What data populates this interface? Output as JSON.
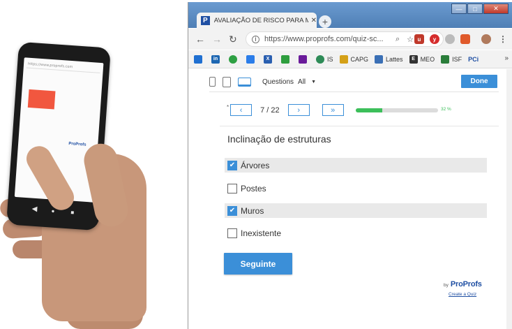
{
  "photo": {
    "phone_url": "https://www.proprofs.com",
    "phone_logo": "ProProfs",
    "phone_nav": [
      "◀",
      "●",
      "■"
    ]
  },
  "browser": {
    "tab_title": "AVALIAÇÃO DE RISCO PARA MO",
    "tab_favicon": "P",
    "url": "https://www.proprofs.com/quiz-sc...",
    "window_buttons": [
      "—",
      "□",
      "✕"
    ]
  },
  "bookmarks": [
    "IS",
    "CAPG",
    "Lattes",
    "MEO",
    "ISF",
    "PCi"
  ],
  "preview": {
    "questions_label": "Questions",
    "questions_value": "All",
    "done_label": "Done"
  },
  "pager": {
    "prev": "‹",
    "counter": "7 / 22",
    "next": "›",
    "last": "»",
    "progress_percent": 32,
    "progress_text": "32 %"
  },
  "question": {
    "title": "Inclinação de estruturas",
    "options": [
      {
        "label": "Árvores",
        "checked": true
      },
      {
        "label": "Postes",
        "checked": false
      },
      {
        "label": "Muros",
        "checked": true
      },
      {
        "label": "Inexistente",
        "checked": false
      }
    ]
  },
  "next_label": "Seguinte",
  "brand": {
    "by": "by",
    "logo": "ProProfs",
    "create": "Create a Quiz"
  },
  "colors": {
    "accent": "#3b8fd8",
    "progress": "#3cbf5a",
    "brand": "#1f4fa3"
  }
}
